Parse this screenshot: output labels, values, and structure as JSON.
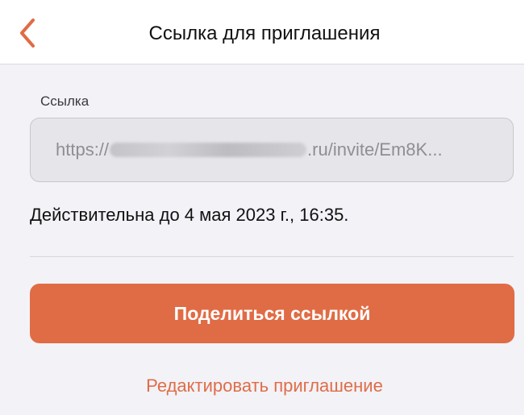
{
  "navbar": {
    "title": "Ссылка для приглашения",
    "back_icon": "chevron-left-icon",
    "accent_color": "#e06c45"
  },
  "link_field": {
    "label": "Ссылка",
    "value_prefix": "https://",
    "value_suffix": ".ru/invite/Em8K..."
  },
  "validity": {
    "text": "Действительна до 4 мая 2023 г., 16:35."
  },
  "actions": {
    "share_label": "Поделиться ссылкой",
    "edit_label": "Редактировать приглашение"
  }
}
